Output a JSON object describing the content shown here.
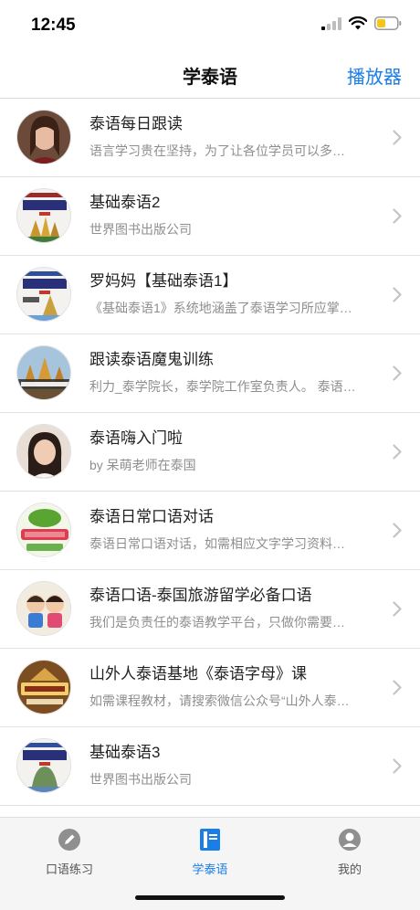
{
  "status": {
    "time": "12:45"
  },
  "nav": {
    "title": "学泰语",
    "action_label": "播放器"
  },
  "colors": {
    "accent": "#1a7ee8",
    "subtitle": "#8e8e8e",
    "battery": "#f5c518"
  },
  "courses": [
    {
      "title": "泰语每日跟读",
      "subtitle": "语言学习贵在坚持，为了让各位学员可以多…",
      "avatar": "portrait-woman-1"
    },
    {
      "title": "基础泰语2",
      "subtitle": "世界图书出版公司",
      "avatar": "book-cover-basic-thai-2"
    },
    {
      "title": "罗妈妈【基础泰语1】",
      "subtitle": "《基础泰语1》系统地涵盖了泰语学习所应掌…",
      "avatar": "book-cover-basic-thai-1"
    },
    {
      "title": "跟读泰语魔鬼训练",
      "subtitle": "利力_泰学院长，泰学院工作室负责人。 泰语…",
      "avatar": "temple-cover"
    },
    {
      "title": "泰语嗨入门啦",
      "subtitle": "by 呆萌老师在泰国",
      "avatar": "portrait-woman-2"
    },
    {
      "title": "泰语日常口语对话",
      "subtitle": "泰语日常口语对话，如需相应文字学习资料…",
      "avatar": "green-cover"
    },
    {
      "title": "泰语口语-泰国旅游留学必备口语",
      "subtitle": "我们是负责任的泰语教学平台，只做你需要…",
      "avatar": "cartoon-kids-cover"
    },
    {
      "title": "山外人泰语基地《泰语字母》课",
      "subtitle": "如需课程教材，请搜索微信公众号“山外人泰…",
      "avatar": "alphabet-cover"
    },
    {
      "title": "基础泰语3",
      "subtitle": "世界图书出版公司",
      "avatar": "book-cover-basic-thai-3"
    }
  ],
  "tabs": [
    {
      "label": "口语练习",
      "icon": "pencil-icon",
      "active": false
    },
    {
      "label": "学泰语",
      "icon": "book-icon",
      "active": true
    },
    {
      "label": "我的",
      "icon": "profile-icon",
      "active": false
    }
  ]
}
